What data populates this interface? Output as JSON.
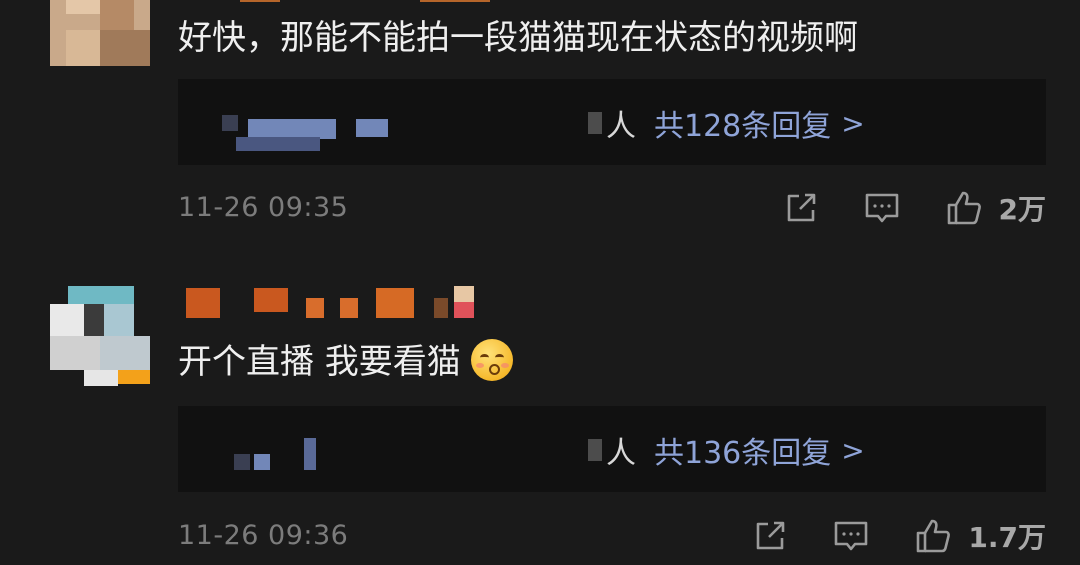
{
  "comments": [
    {
      "text": "好快，那能不能拍一段猫猫现在状态的视频啊",
      "reply_who": "人",
      "reply_count": "共128条回复",
      "reply_chevron": ">",
      "time": "11-26 09:35",
      "likes": "2万"
    },
    {
      "text": "开个直播 我要看猫",
      "emoji": "kissing-smiling-eyes-emoji",
      "reply_who": "人",
      "reply_count": "共136条回复",
      "reply_chevron": ">",
      "time": "11-26 09:36",
      "likes": "1.7万"
    }
  ],
  "icons": {
    "share": "share-icon",
    "comment": "comment-icon",
    "like": "thumbs-up-icon"
  },
  "colors": {
    "background": "#1a1a1a",
    "reply_box": "#111111",
    "link": "#8fa4d8",
    "muted": "#7c7c7c"
  }
}
